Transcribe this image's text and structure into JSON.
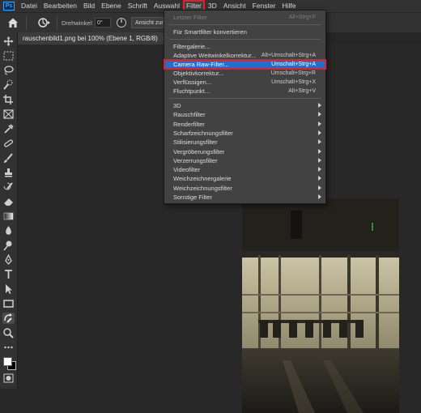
{
  "menubar": {
    "logo": "Ps",
    "items": [
      "Datei",
      "Bearbeiten",
      "Bild",
      "Ebene",
      "Schrift",
      "Auswahl",
      "Filter",
      "3D",
      "Ansicht",
      "Fenster",
      "Hilfe"
    ],
    "active": "Filter"
  },
  "options": {
    "angle_label": "Drehwinkel:",
    "angle_value": "0°",
    "reset_view": "Ansicht zurücksetzen"
  },
  "document": {
    "tab_title": "rauschenbild1.png bei 100% (Ebene 1, RGB/8)",
    "close": "×"
  },
  "filter_menu": {
    "last_filter": {
      "label": "Letzter Filter",
      "shortcut": "Alt+Strg+F"
    },
    "convert_smart": {
      "label": "Für Smartfilter konvertieren"
    },
    "gallery": {
      "label": "Filtergalerie..."
    },
    "adaptive_wide": {
      "label": "Adaptive Weitwinkelkorrektur...",
      "shortcut": "Alt+Umschalt+Strg+A"
    },
    "camera_raw": {
      "label": "Camera Raw-Filter...",
      "shortcut": "Umschalt+Strg+A"
    },
    "lens_correction": {
      "label": "Objektivkorrektur...",
      "shortcut": "Umschalt+Strg+R"
    },
    "liquify": {
      "label": "Verflüssigen...",
      "shortcut": "Umschalt+Strg+X"
    },
    "vanishing_point": {
      "label": "Fluchtpunkt...",
      "shortcut": "Alt+Strg+V"
    },
    "submenus": [
      "3D",
      "Rauschfilter",
      "Renderfilter",
      "Scharfzeichnungsfilter",
      "Stilisierungsfilter",
      "Vergröberungsfilter",
      "Verzerrungsfilter",
      "Videofilter",
      "Weichzeichnergalerie",
      "Weichzeichnungsfilter",
      "Sonstige Filter"
    ]
  },
  "colors": {
    "highlight": "#1f6fd1",
    "annotation_red": "#e0202a",
    "menu_bg": "#424242"
  }
}
